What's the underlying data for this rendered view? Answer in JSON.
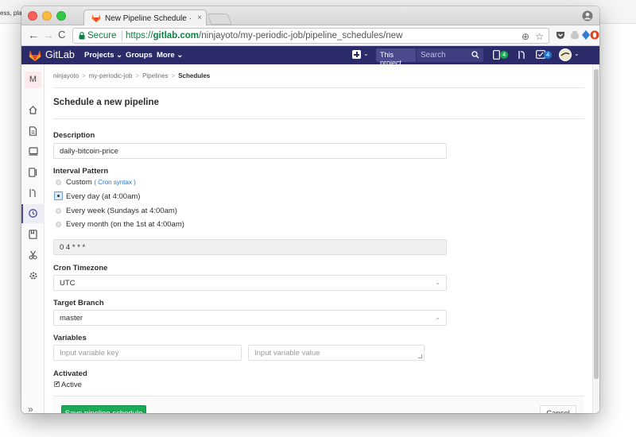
{
  "background": {
    "cutoff_text": "ess, pla"
  },
  "browser": {
    "tab_title": "New Pipeline Schedule · ninjayoto",
    "tab_close": "×",
    "nav_back": "←",
    "nav_forward": "→",
    "nav_reload": "C",
    "secure_label": "Secure",
    "url_scheme": "https://",
    "url_host": "gitlab.com",
    "url_path": "/ninjayoto/my-periodic-job/pipeline_schedules/new",
    "zoom_glyph": "⊕",
    "star_glyph": "☆"
  },
  "gitlab_header": {
    "brand": "GitLab",
    "nav": {
      "projects": "Projects ⌄",
      "groups": "Groups",
      "more": "More ⌄"
    },
    "plus_caret": "⌄",
    "search_scope": "This project",
    "search_placeholder": "Search",
    "issues_count": "4",
    "todos_count": "4",
    "avatar_caret": "⌄"
  },
  "sidebar": {
    "project_avatar_letter": "M",
    "collapse_label": "»"
  },
  "breadcrumb": {
    "items": [
      "ninjayoto",
      "my-periodic-job",
      "Pipelines"
    ],
    "separator": ">",
    "current": "Schedules"
  },
  "page": {
    "title": "Schedule a new pipeline"
  },
  "form": {
    "description": {
      "label": "Description",
      "value": "daily-bitcoin-price"
    },
    "interval": {
      "label": "Interval Pattern",
      "custom_label": "Custom",
      "cron_syntax_link": "Cron syntax",
      "options": [
        "Every day (at 4:00am)",
        "Every week (Sundays at 4:00am)",
        "Every month (on the 1st at 4:00am)"
      ],
      "selected": "Every day (at 4:00am)",
      "cron_value": "0 4 * * *"
    },
    "timezone": {
      "label": "Cron Timezone",
      "value": "UTC"
    },
    "branch": {
      "label": "Target Branch",
      "value": "master"
    },
    "variables": {
      "label": "Variables",
      "key_placeholder": "Input variable key",
      "value_placeholder": "Input variable value"
    },
    "activated": {
      "label": "Activated",
      "checkbox_label": "Active",
      "checked": true,
      "check_glyph": "✔"
    },
    "caret_glyph": "⌄",
    "save_label": "Save pipeline schedule",
    "cancel_label": "Cancel"
  },
  "colors": {
    "header_bg": "#2b2b6a",
    "save_green": "#1aaa55",
    "link_blue": "#1f78d1",
    "secure_green": "#0b8043"
  }
}
